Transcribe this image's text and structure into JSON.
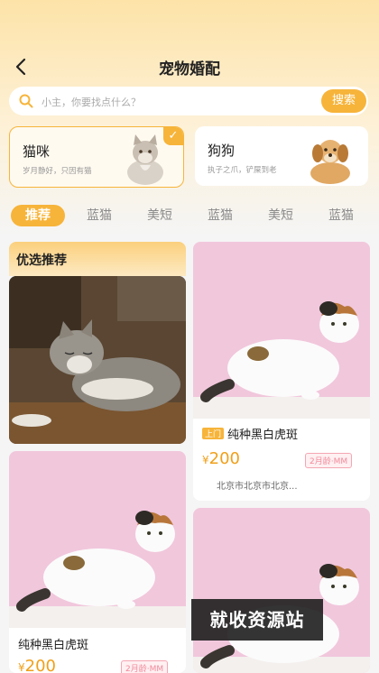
{
  "header": {
    "title": "宠物婚配"
  },
  "search": {
    "placeholder": "小主，你要找点什么？",
    "button": "搜索"
  },
  "categories": [
    {
      "name": "猫咪",
      "sub": "岁月静好，只因有猫",
      "selected": true
    },
    {
      "name": "狗狗",
      "sub": "执子之爪，铲屎到老",
      "selected": false
    }
  ],
  "tabs": [
    "推荐",
    "蓝猫",
    "美短",
    "蓝猫",
    "美短",
    "蓝猫"
  ],
  "featured": {
    "label": "优选推荐"
  },
  "listings": [
    {
      "tag": "上门",
      "title": "纯种黑白虎斑",
      "price_symbol": "¥",
      "price": "200",
      "age": "2月龄·MM",
      "location": "北京市北京市北京..."
    },
    {
      "title": "纯种黑白虎斑",
      "price_symbol": "¥",
      "price": "200",
      "age": "2月龄·MM"
    }
  ],
  "watermark": "就收资源站",
  "colors": {
    "accent": "#f7b43a",
    "pink_bg": "#f1c7dc",
    "price": "#f0a01a"
  }
}
